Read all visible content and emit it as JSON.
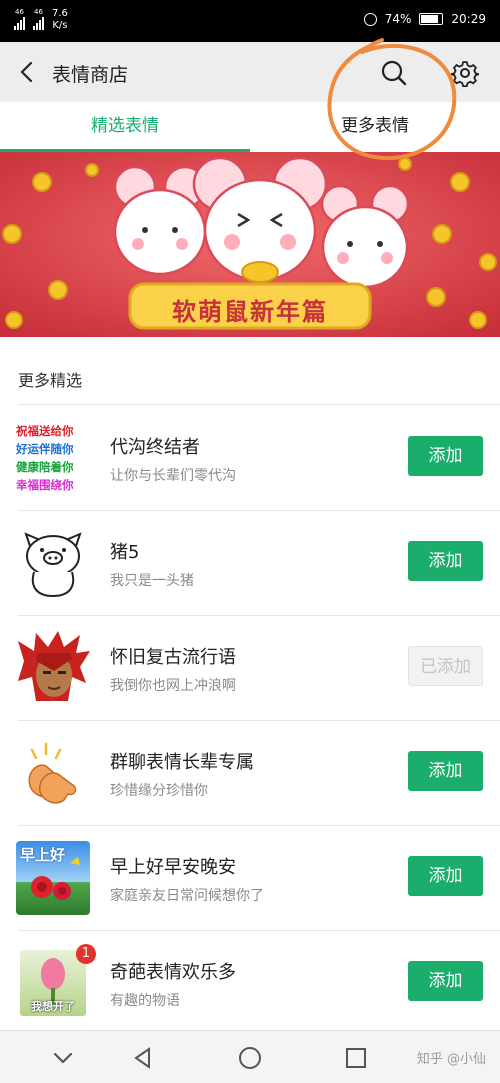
{
  "status_bar": {
    "signal_1": "46",
    "signal_2": "46",
    "net_speed_value": "7.6",
    "net_speed_unit": "K/s",
    "battery": "74%",
    "time": "20:29",
    "battery_level": 0.74
  },
  "header": {
    "title": "表情商店",
    "back_icon": "chevron-left-icon",
    "search_icon": "search-icon",
    "settings_icon": "gear-icon"
  },
  "tabs": [
    {
      "label": "精选表情",
      "active": true
    },
    {
      "label": "更多表情",
      "active": false
    }
  ],
  "banner": {
    "title": "软萌鼠新年篇"
  },
  "section": {
    "title": "更多精选"
  },
  "items": [
    {
      "name": "代沟终结者",
      "desc": "让你与长辈们零代沟",
      "button": "添加",
      "added": false,
      "thumb_lines": [
        "祝福送给你",
        "好运伴随你",
        "健康陪着你",
        "幸福围绕你"
      ]
    },
    {
      "name": "猪5",
      "desc": "我只是一头猪",
      "button": "添加",
      "added": false
    },
    {
      "name": "怀旧复古流行语",
      "desc": "我倒你也网上冲浪啊",
      "button": "已添加",
      "added": true
    },
    {
      "name": "群聊表情长辈专属",
      "desc": "珍惜缘分珍惜你",
      "button": "添加",
      "added": false
    },
    {
      "name": "早上好早安晚安",
      "desc": "家庭亲友日常问候想你了",
      "button": "添加",
      "added": false,
      "thumb_text": "早上好"
    },
    {
      "name": "奇葩表情欢乐多",
      "desc": "有趣的物语",
      "button": "添加",
      "added": false,
      "thumb_text": "我想开了",
      "badge": "1"
    }
  ],
  "nav": {
    "icons": [
      "chevron-down-icon",
      "back-triangle-icon",
      "home-circle-icon",
      "recents-square-icon"
    ],
    "watermark": "知乎 @小仙"
  },
  "colors": {
    "accent": "#1aad6b",
    "banner_bg": "#e0474f",
    "annotation": "#f08a3c"
  }
}
